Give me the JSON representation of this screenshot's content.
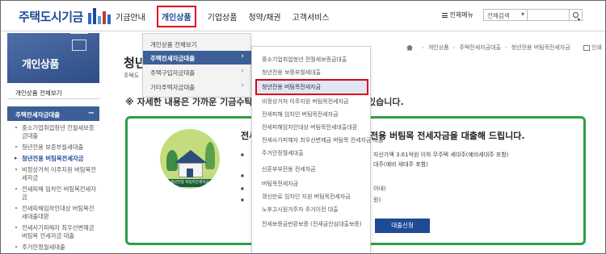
{
  "header": {
    "logo_text": "주택도시기금",
    "logo_colors": [
      "#2b6bc4",
      "#1f4a96",
      "#4fa3e0",
      "#c53a3a",
      "#2b6bc4"
    ],
    "nav": [
      "기금안내",
      "개인상품",
      "기업상품",
      "청약/채권",
      "고객서비스"
    ],
    "active_nav": "개인상품",
    "all_menu_label": "전체메뉴",
    "search_scope": "전체검색",
    "search_placeholder": ""
  },
  "sidebar": {
    "banner_title": "개인상품",
    "all_link": "개인상품 전체보기",
    "category": "주택전세자금대출",
    "category_toggle": "−",
    "items": [
      "중소기업취업청년 전월세보증금대출",
      "청년전용 보증부월세대출",
      "청년전용 버팀목전세자금",
      "비정상거처 이주지원 버팀목전세자금",
      "전세피해 임차인 버팀목전세자금",
      "전세피해임차인대상 버팀목전세대출대환",
      "전세사기피해자 최우선변제금 버팀목 전세자금 대출",
      "주거안정월세대출"
    ],
    "active_index": 2
  },
  "main": {
    "title": "청년",
    "subtitle": "주택도",
    "breadcrumb": [
      "개인상품",
      "주택전세자금대출",
      "청년전용 버팀목전세자금"
    ],
    "print_label": "인쇄",
    "notice_left": "※ 자세한 내용은 가까운 기금수탁",
    "notice_right": "있습니다.",
    "card": {
      "title_left": "전세",
      "title_right": "전용 버팀목 전세자금을 대출해 드립니다.",
      "emblem_ribbon": "청년전용 버팀목전세자금",
      "bullets": [
        "자산가액 3.61억원 이하 무주택 세대주(예비세대주 포함)",
        "대주(예비 세대주 포함)",
        "이내)",
        "원)"
      ],
      "button_label": "대출신청"
    }
  },
  "dropdown": {
    "level1": [
      "개인상품 전체보기",
      "주택전세자금대출",
      "주택구입자금대출",
      "기타주택자금대출"
    ],
    "level1_selected": 1,
    "level2": [
      "중소기업취업청년 전월세보증금대출",
      "청년전용 보증부월세대출",
      "청년전용 버팀목전세자금",
      "비정상거처 이주지원 버팀목전세자금",
      "전세피해 임차인 버팀목전세자금",
      "전세피해임차인대상 버팀목전세대출대환",
      "전세사기피해자 최우선변제금 버팀목 전세자금 대출",
      "주거안정월세대출",
      "신혼부부전용 전세자금",
      "버팀목전세자금",
      "갱신만료 임차인 지원 버팀목전세자금",
      "노후고시원거주자 주거이전 대출",
      "전세보증금반환보증 (전세금안심대출보증)"
    ],
    "level2_highlighted": 2
  },
  "colors": {
    "brand_blue": "#1f4a96",
    "nav_selected_bg": "#3d5f97",
    "card_border": "#2f9e4a",
    "highlight_box": "#e0001b"
  }
}
